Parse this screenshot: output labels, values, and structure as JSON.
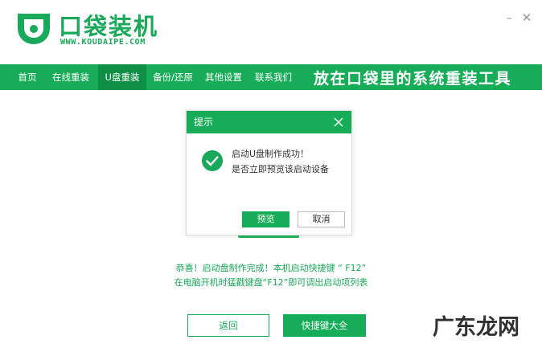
{
  "app": {
    "brand_name": "口袋装机",
    "brand_url": "WWW.KOUDAIPE.COM",
    "minimize_glyph": "–",
    "close_glyph": "✕"
  },
  "nav": {
    "items": [
      {
        "label": "首页",
        "active": false
      },
      {
        "label": "在线重装",
        "active": false
      },
      {
        "label": "U盘重装",
        "active": true
      },
      {
        "label": "备份/还原",
        "active": false
      },
      {
        "label": "其他设置",
        "active": false
      },
      {
        "label": "联系我们",
        "active": false
      }
    ],
    "slogan": "放在口袋里的系统重装工具"
  },
  "dialog": {
    "title": "提示",
    "message_line1": "启动U盘制作成功！",
    "message_line2": "是否立即预览该启动设备",
    "preview_label": "预览",
    "cancel_label": "取消"
  },
  "main": {
    "congrats_line1": "恭喜！启动盘制作完成！本机启动快捷键 “ F12”",
    "congrats_line2": "在电脑开机时猛戳键盘“F12”即可调出启动项列表",
    "back_label": "返回",
    "hotkeys_label": "快捷键大全"
  },
  "watermark": "广东龙网",
  "colors": {
    "brand_green": "#17ad58",
    "nav_active": "#0f8e45",
    "text_dark": "#333333"
  },
  "icons": [
    "logo-mark-icon",
    "minimize-icon",
    "close-icon",
    "dialog-close-icon",
    "success-check-icon"
  ]
}
